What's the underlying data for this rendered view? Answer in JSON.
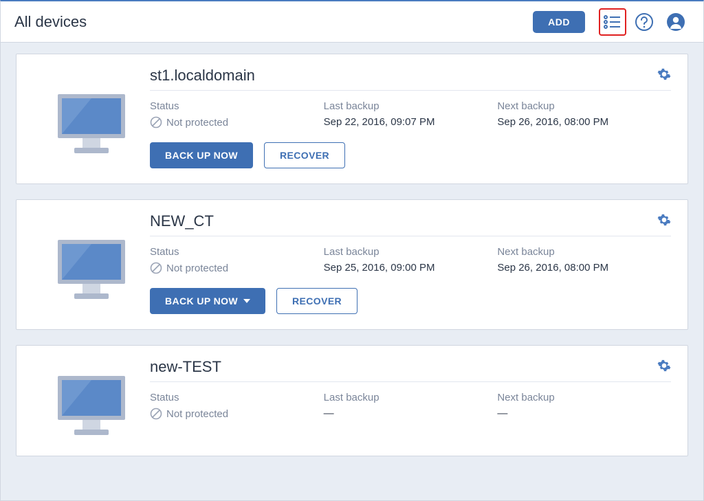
{
  "header": {
    "title": "All devices",
    "add_label": "ADD"
  },
  "labels": {
    "status": "Status",
    "last_backup": "Last backup",
    "next_backup": "Next backup",
    "backup_now": "BACK UP NOW",
    "recover": "RECOVER",
    "not_protected": "Not protected",
    "dash": "—"
  },
  "devices": [
    {
      "name": "st1.localdomain",
      "status": "Not protected",
      "last_backup": "Sep 22, 2016, 09:07 PM",
      "next_backup": "Sep 26, 2016, 08:00 PM",
      "backup_dropdown": false,
      "show_actions": true
    },
    {
      "name": "NEW_CT",
      "status": "Not protected",
      "last_backup": "Sep 25, 2016, 09:00 PM",
      "next_backup": "Sep 26, 2016, 08:00 PM",
      "backup_dropdown": true,
      "show_actions": true
    },
    {
      "name": "new-TEST",
      "status": "Not protected",
      "last_backup": "—",
      "next_backup": "—",
      "backup_dropdown": false,
      "show_actions": false
    }
  ]
}
